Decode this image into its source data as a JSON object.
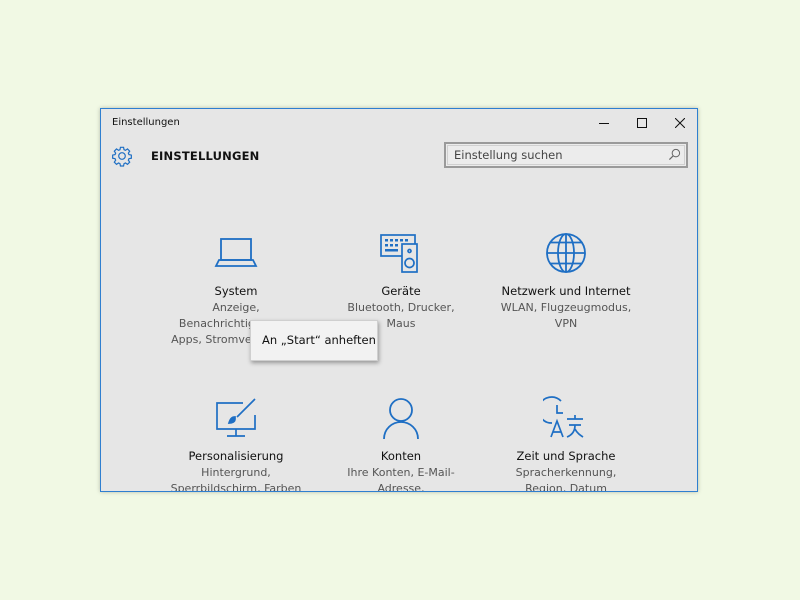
{
  "window": {
    "title": "Einstellungen",
    "accent_color": "#2f7fd0"
  },
  "header": {
    "title": "EINSTELLUNGEN",
    "icon": "gear-icon"
  },
  "search": {
    "placeholder": "Einstellung suchen",
    "icon": "search-icon"
  },
  "tiles": [
    {
      "name": "System",
      "desc": [
        "Anzeige,",
        "Benachrichtigungen,",
        "Apps, Stromversorgung"
      ],
      "icon": "laptop-icon"
    },
    {
      "name": "Geräte",
      "desc": [
        "Bluetooth, Drucker,",
        "Maus"
      ],
      "icon": "devices-icon"
    },
    {
      "name": "Netzwerk und Internet",
      "desc": [
        "WLAN, Flugzeugmodus,",
        "VPN"
      ],
      "icon": "globe-icon"
    },
    {
      "name": "Personalisierung",
      "desc": [
        "Hintergrund,",
        "Sperrbildschirm, Farben"
      ],
      "icon": "paint-icon"
    },
    {
      "name": "Konten",
      "desc": [
        "Ihre Konten, E-Mail-",
        "Adresse,"
      ],
      "icon": "user-icon"
    },
    {
      "name": "Zeit und Sprache",
      "desc": [
        "Spracherkennung,",
        "Region, Datum"
      ],
      "icon": "time-language-icon"
    }
  ],
  "context_menu": {
    "item": "An „Start“ anheften"
  }
}
